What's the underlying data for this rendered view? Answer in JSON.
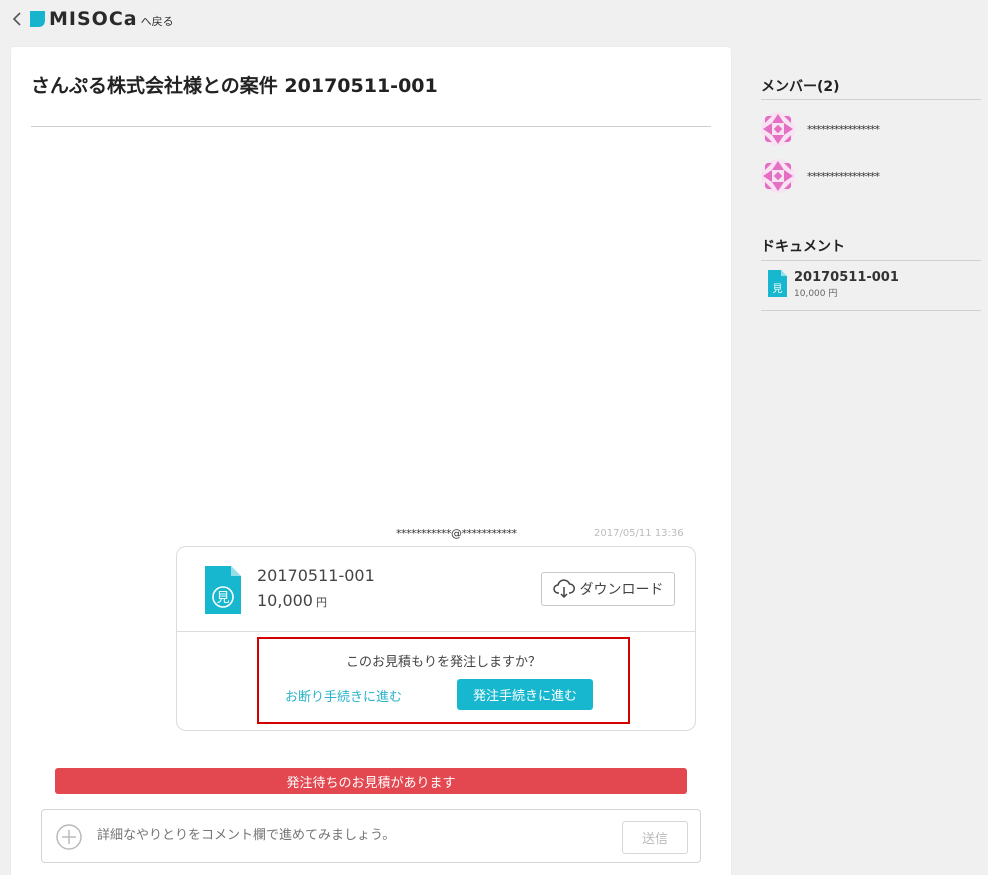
{
  "header": {
    "logo_text": "MISOCa",
    "back_label": "へ戻る"
  },
  "main": {
    "title": "さんぷる株式会社様との案件 20170511-001",
    "message": {
      "sender": "***********@***********",
      "timestamp": "2017/05/11 13:36",
      "document": {
        "number": "20170511-001",
        "amount": "10,000",
        "currency": "円",
        "icon_char": "見",
        "download_label": "ダウンロード"
      },
      "confirm": {
        "question": "このお見積もりを発注しますか？",
        "decline_label": "お断り手続きに進む",
        "order_label": "発注手続きに進む"
      }
    },
    "pending_banner": "発注待ちのお見積があります",
    "comment": {
      "placeholder": "詳細なやりとりをコメント欄で進めてみましょう。",
      "send_label": "送信"
    }
  },
  "sidebar": {
    "members_heading": "メンバー(2)",
    "members": [
      {
        "name": "****************"
      },
      {
        "name": "****************"
      }
    ],
    "documents_heading": "ドキュメント",
    "documents": [
      {
        "number": "20170511-001",
        "amount": "10,000 円",
        "icon_char": "見"
      }
    ]
  },
  "colors": {
    "accent": "#17b8cf",
    "danger": "#e3474f",
    "highlight_border": "#d40000",
    "avatar": "#e46fc3"
  }
}
